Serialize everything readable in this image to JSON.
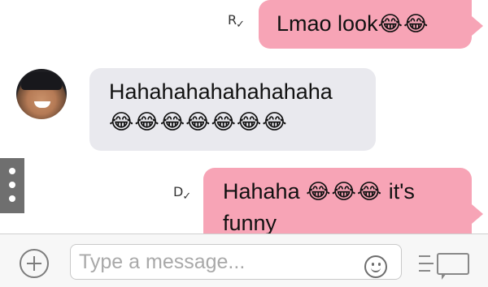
{
  "messages": [
    {
      "direction": "outgoing",
      "text": "Lmao look",
      "emoji": "😂😂",
      "receipt": "R"
    },
    {
      "direction": "incoming",
      "text": "Hahahahahahahahaha",
      "emoji": "😂😂😂😂😂😂😂"
    },
    {
      "direction": "outgoing",
      "text_before": "Hahaha",
      "emoji": "😂😂😂",
      "text_after": "it's",
      "text_line2": "funny",
      "receipt": "D"
    }
  ],
  "composer": {
    "placeholder": "Type a message..."
  },
  "colors": {
    "outgoing_bubble": "#f7a4b6",
    "incoming_bubble": "#e9e9ee",
    "side_handle": "#6f6f6f"
  },
  "icons": [
    "add-icon",
    "emoji-icon",
    "send-icon",
    "more-options-icon",
    "read-receipt-check-icon"
  ]
}
